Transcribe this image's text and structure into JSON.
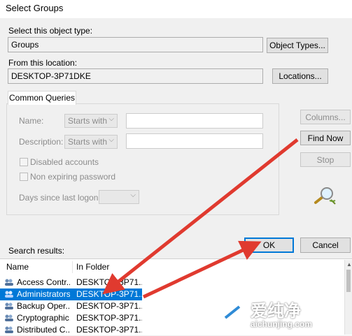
{
  "window": {
    "title": "Select Groups"
  },
  "object_type": {
    "label": "Select this object type:",
    "value": "Groups",
    "button": "Object Types..."
  },
  "location": {
    "label": "From this location:",
    "value": "DESKTOP-3P71DKE",
    "button": "Locations..."
  },
  "queries": {
    "tab": "Common Queries",
    "name_label": "Name:",
    "name_mode": "Starts with",
    "description_label": "Description:",
    "description_mode": "Starts with",
    "disabled_label": "Disabled accounts",
    "nonexpiring_label": "Non expiring password",
    "days_label": "Days since last logon:"
  },
  "side_buttons": {
    "columns": "Columns...",
    "find_now": "Find Now",
    "stop": "Stop"
  },
  "results": {
    "label": "Search results:",
    "columns": [
      "Name",
      "In Folder"
    ],
    "rows": [
      {
        "name": "Access Contr...",
        "folder": "DESKTOP-3P71..."
      },
      {
        "name": "Administrators",
        "folder": "DESKTOP-3P71...",
        "selected": true
      },
      {
        "name": "Backup Oper...",
        "folder": "DESKTOP-3P71..."
      },
      {
        "name": "Cryptographic...",
        "folder": "DESKTOP-3P71..."
      },
      {
        "name": "Distributed C...",
        "folder": "DESKTOP-3P71..."
      }
    ]
  },
  "footer": {
    "ok": "OK",
    "cancel": "Cancel"
  },
  "watermark": {
    "brand": "爱纯净",
    "url": "aichunjing.com"
  },
  "colors": {
    "accent": "#0078d7",
    "annotation_arrow": "#e03a2f"
  }
}
